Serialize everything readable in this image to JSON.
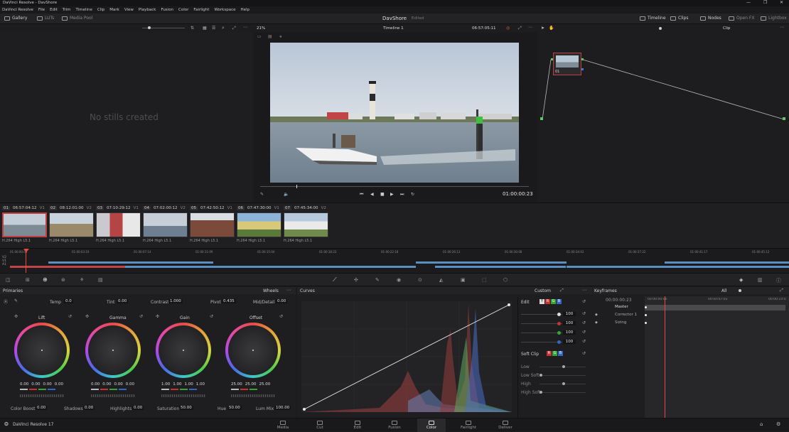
{
  "app": {
    "title": "DaVinci Resolve - DavShore",
    "project": "DavShore",
    "status": "Edited",
    "footer_name": "DaVinci Resolve 17"
  },
  "menu": [
    "DaVinci Resolve",
    "File",
    "Edit",
    "Trim",
    "Timeline",
    "Clip",
    "Mark",
    "View",
    "Playback",
    "Fusion",
    "Color",
    "Fairlight",
    "Workspace",
    "Help"
  ],
  "toolbar": {
    "left": [
      "Gallery",
      "LUTs",
      "Media Pool"
    ],
    "right": [
      "Timeline",
      "Clips",
      "Nodes",
      "Open FX",
      "Lightbox"
    ]
  },
  "gallery": {
    "empty": "No stills created"
  },
  "viewer": {
    "zoom": "21%",
    "timeline": "Timeline 1",
    "source_tc": "06:57:05:11",
    "record_tc": "01:00:00:23",
    "clip_mode": "Clip"
  },
  "node": {
    "label": "01"
  },
  "clips": [
    {
      "num": "01",
      "tc": "06:57:04:12",
      "track": "V1",
      "codec": "H.264 High L5.1"
    },
    {
      "num": "02",
      "tc": "08:12:01:00",
      "track": "V2",
      "codec": "H.264 High L5.1"
    },
    {
      "num": "03",
      "tc": "07:10:29:12",
      "track": "V1",
      "codec": "H.264 High L5.1"
    },
    {
      "num": "04",
      "tc": "07:02:00:12",
      "track": "V2",
      "codec": "H.264 High L5.1"
    },
    {
      "num": "05",
      "tc": "07:42:50:12",
      "track": "V1",
      "codec": "H.264 High L5.1"
    },
    {
      "num": "06",
      "tc": "07:47:30:00",
      "track": "V1",
      "codec": "H.264 High L5.1"
    },
    {
      "num": "07",
      "tc": "07:45:34:00",
      "track": "V2",
      "codec": "H.264 High L5.1"
    }
  ],
  "ruler": [
    "01:00:00:00",
    "01:00:03:19",
    "01:00:07:14",
    "01:00:11:09",
    "01:00:15:04",
    "01:00:18:23",
    "01:00:22:18",
    "01:00:26:13",
    "01:00:30:08",
    "01:00:34:03",
    "01:00:37:22",
    "01:00:41:17",
    "01:00:45:12"
  ],
  "tracks": [
    "V2",
    "V1",
    "A1"
  ],
  "primaries": {
    "title": "Primaries",
    "mode": "Wheels",
    "temp_label": "Temp",
    "temp": "0.0",
    "tint_label": "Tint",
    "tint": "0.00",
    "contrast_label": "Contrast",
    "contrast": "1.000",
    "pivot_label": "Pivot",
    "pivot": "0.435",
    "middetail_label": "Mid/Detail",
    "middetail": "0.00",
    "wheels": [
      {
        "name": "Lift",
        "vals": [
          "0.00",
          "0.00",
          "0.00",
          "0.00"
        ]
      },
      {
        "name": "Gamma",
        "vals": [
          "0.00",
          "0.00",
          "0.00",
          "0.00"
        ]
      },
      {
        "name": "Gain",
        "vals": [
          "1.00",
          "1.00",
          "1.00",
          "1.00"
        ]
      },
      {
        "name": "Offset",
        "vals": [
          "25.00",
          "25.00",
          "25.00"
        ]
      }
    ],
    "bottom": [
      {
        "label": "Color Boost",
        "val": "0.00"
      },
      {
        "label": "Shadows",
        "val": "0.00"
      },
      {
        "label": "Highlights",
        "val": "0.00"
      },
      {
        "label": "Saturation",
        "val": "50.00"
      },
      {
        "label": "Hue",
        "val": "50.00"
      },
      {
        "label": "Lum Mix",
        "val": "100.00"
      }
    ]
  },
  "curves": {
    "title": "Curves",
    "mode": "Custom",
    "edit_label": "Edit",
    "edit_vals": [
      "100",
      "100",
      "100",
      "100"
    ],
    "softclip_label": "Soft Clip",
    "softclip_rows": [
      "Low",
      "Low Soft",
      "High",
      "High Soft"
    ],
    "swatches": [
      "Y",
      "R",
      "G",
      "B"
    ]
  },
  "keyframes": {
    "title": "Keyframes",
    "filter": "All",
    "tc": "00:00:00:23",
    "ruler": [
      "00:00:00:00",
      "00:00:07:03",
      "00:00:14:0"
    ],
    "rows": [
      "Master",
      "Corrector 1",
      "Sizing"
    ]
  },
  "pages": [
    "Media",
    "Cut",
    "Edit",
    "Fusion",
    "Color",
    "Fairlight",
    "Deliver"
  ],
  "active_page": "Color",
  "colors": {
    "accent": "#e64b3c",
    "clip_selected": "#c04040",
    "timeline_bar": "#5b8fc0"
  }
}
